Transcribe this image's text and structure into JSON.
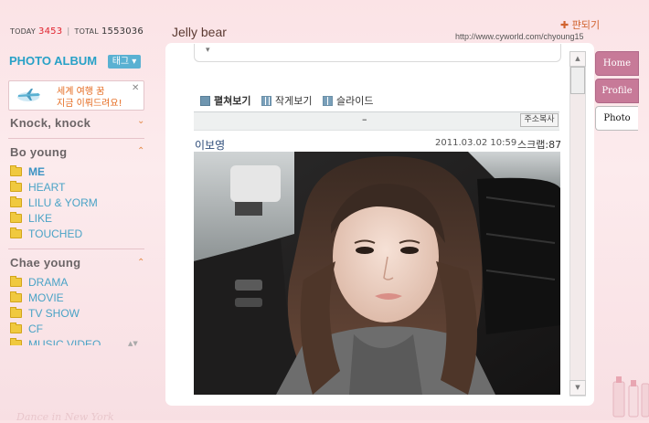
{
  "counter": {
    "today_label": "TODAY",
    "today_value": "3453",
    "total_label": "TOTAL",
    "total_value": "1553036"
  },
  "sidebar": {
    "album_title": "PHOTO ALBUM",
    "tag_button": "태그 ▾",
    "ad": {
      "line1": "세계 여행 꿈",
      "line2": "지금 이뤄드려요!",
      "close": "✕"
    },
    "sections": [
      {
        "title": "Knock, knock",
        "arrow": "⌄",
        "items": []
      },
      {
        "title": "Bo young",
        "arrow": "⌃",
        "items": [
          "ME",
          "HEART",
          "LILU & YORM",
          "LIKE",
          "TOUCHED"
        ]
      },
      {
        "title": "Chae young",
        "arrow": "⌃",
        "items": [
          "DRAMA",
          "MOVIE",
          "TV SHOW",
          "CF",
          "MUSIC VIDEO"
        ]
      }
    ],
    "scroll_glyph": "▲▼"
  },
  "header": {
    "title": "Jelly bear",
    "paneul_link": "✚ 퍈되기",
    "url": "http://www.cyworld.com/chyoung15"
  },
  "main": {
    "view_options": [
      "펼쳐보기",
      "작게보기",
      "슬라이드"
    ],
    "post_dash": "–",
    "copy_url": "주소복사",
    "author": "이보영",
    "date": "2011.03.02 10:59",
    "scrap": "스크랩:87"
  },
  "scrollbar": {
    "up": "▲",
    "down": "▼"
  },
  "tabs": {
    "home": "Home",
    "profile": "Profile",
    "photo": "Photo"
  },
  "footer": {
    "deco_text": "Dance in New York"
  },
  "colors": {
    "accent_blue": "#28a1c7",
    "tab_pink": "#c77a98",
    "counter_red": "#e0232e"
  }
}
